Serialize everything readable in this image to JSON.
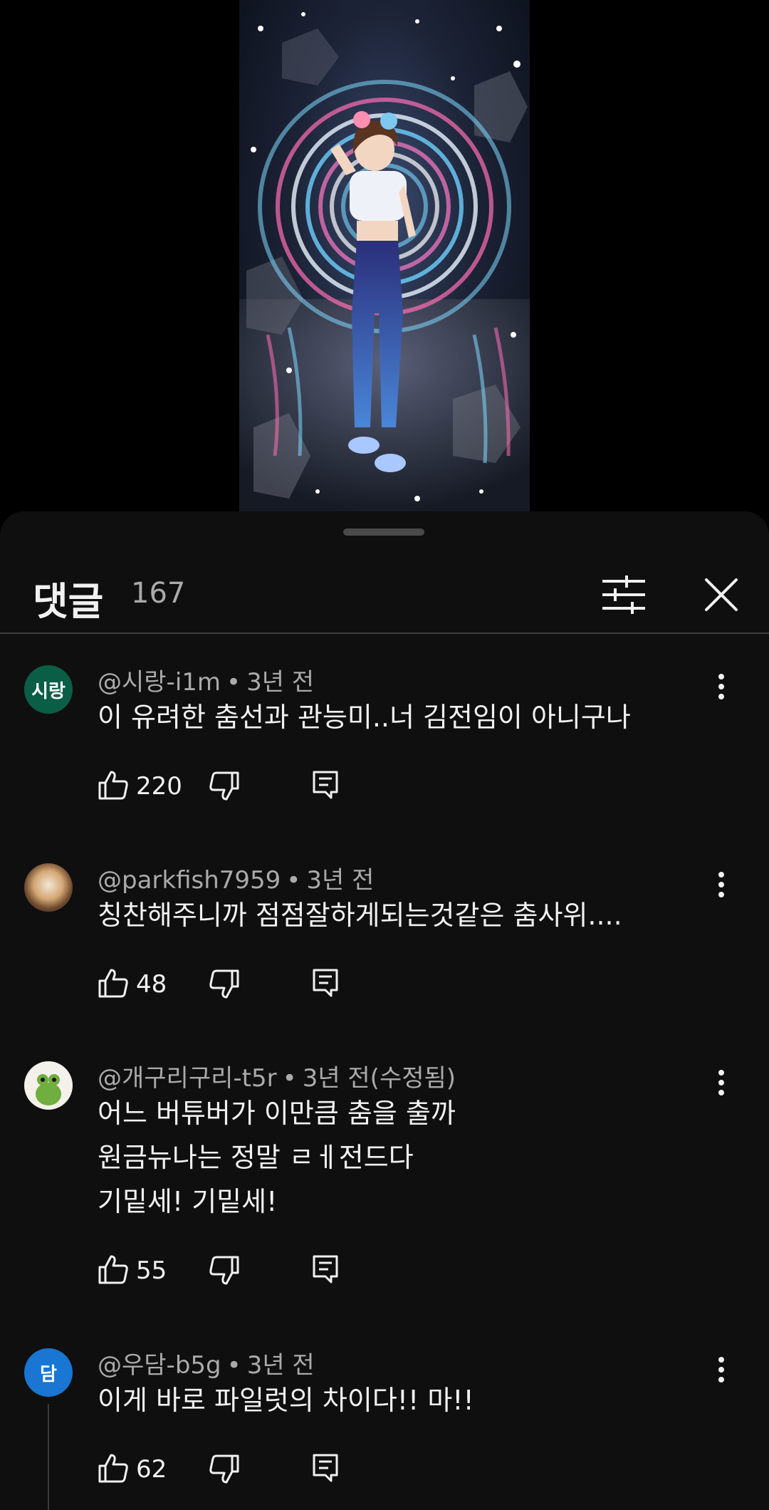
{
  "comments_panel": {
    "title": "댓글",
    "count": "167"
  },
  "icons": {
    "filter": "sort-filter-icon",
    "close": "close-icon",
    "more": "more-vert-icon",
    "like": "thumb-up-icon",
    "dislike": "thumb-down-icon",
    "reply": "reply-comment-icon"
  },
  "comments": [
    {
      "author": "@시랑-i1m",
      "time": "3년 전",
      "avatar_text": "시랑",
      "avatar_color": "#0b5e46",
      "lines": [
        "이 유려한 춤선과 관능미..너 김전임이 아니구나"
      ],
      "likes": "220"
    },
    {
      "author": "@parkfish7959",
      "time": "3년 전",
      "avatar_text": "",
      "avatar_color": "#5a4a3a",
      "lines": [
        "칭찬해주니까 점점잘하게되는것같은 춤사위...."
      ],
      "likes": "48"
    },
    {
      "author": "@개구리구리-t5r",
      "time": "3년 전(수정됨)",
      "avatar_text": "",
      "avatar_color": "#f4f1ea",
      "lines": [
        "어느 버튜버가 이만큼 춤을 출까",
        "원금뉴나는 정말 ㄹㅔ전드다",
        "기밑세! 기밑세!"
      ],
      "likes": "55"
    },
    {
      "author": "@우담-b5g",
      "time": "3년 전",
      "avatar_text": "담",
      "avatar_color": "#1976d2",
      "lines": [
        "이게 바로 파일럿의 차이다!! 마!!"
      ],
      "likes": "62"
    }
  ]
}
